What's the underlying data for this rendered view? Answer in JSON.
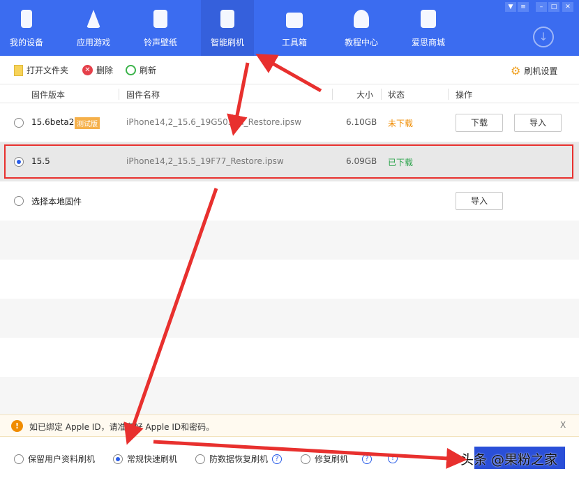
{
  "nav": [
    {
      "label": "我的设备",
      "icon": "phone-icon"
    },
    {
      "label": "应用游戏",
      "icon": "app-store-icon"
    },
    {
      "label": "铃声壁纸",
      "icon": "music-icon"
    },
    {
      "label": "智能刷机",
      "icon": "refresh-icon",
      "active": true
    },
    {
      "label": "工具箱",
      "icon": "toolbox-icon"
    },
    {
      "label": "教程中心",
      "icon": "graduation-cap-icon"
    },
    {
      "label": "爱思商城",
      "icon": "store-icon"
    }
  ],
  "toolbar": {
    "open_folder": "打开文件夹",
    "delete": "删除",
    "refresh": "刷新",
    "settings": "刷机设置"
  },
  "table": {
    "headers": [
      "固件版本",
      "固件名称",
      "大小",
      "状态",
      "操作"
    ],
    "rows": [
      {
        "version": "15.6beta2",
        "badge": "测试版",
        "name": "iPhone14,2_15.6_19G5037d_Restore.ipsw",
        "size": "6.10GB",
        "status": "未下载",
        "actions": [
          "下载",
          "导入"
        ]
      },
      {
        "version": "15.5",
        "name": "iPhone14,2_15.5_19F77_Restore.ipsw",
        "size": "6.09GB",
        "status": "已下载",
        "selected": true
      },
      {
        "version": "选择本地固件",
        "actions": [
          "导入"
        ]
      }
    ]
  },
  "notice": {
    "text": "如已绑定 Apple ID，请准备好 Apple ID和密码。",
    "close": "X"
  },
  "modes": [
    {
      "label": "保留用户资料刷机"
    },
    {
      "label": "常规快速刷机",
      "selected": true
    },
    {
      "label": "防数据恢复刷机",
      "help": "?"
    },
    {
      "label": "修复刷机",
      "help": "?"
    }
  ],
  "watermark": "头条 @果粉之家",
  "colors": {
    "brand": "#3b6cf0",
    "annotation": "#e8302e",
    "orange": "#f08c00",
    "green": "#2aa34a"
  }
}
